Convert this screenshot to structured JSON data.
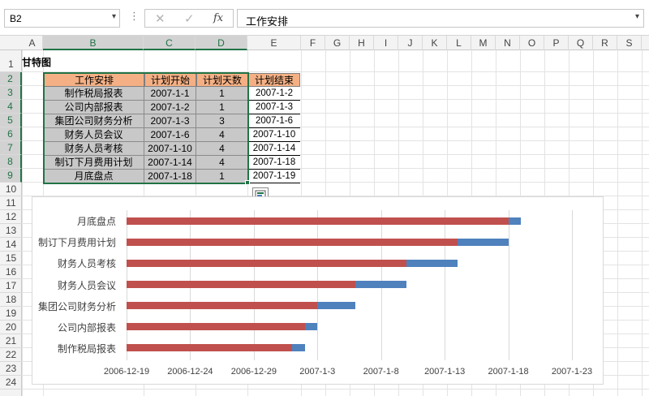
{
  "formula_bar": {
    "name_box": "B2",
    "formula": "工作安排",
    "fx_label": "fx",
    "cancel_glyph": "✕",
    "enter_glyph": "✓"
  },
  "columns": [
    "A",
    "B",
    "C",
    "D",
    "E",
    "F",
    "G",
    "H",
    "I",
    "J",
    "K",
    "L",
    "M",
    "N",
    "O",
    "P",
    "Q",
    "R",
    "S"
  ],
  "rows": [
    "1",
    "2",
    "3",
    "4",
    "5",
    "6",
    "7",
    "8",
    "9",
    "10",
    "11",
    "12",
    "13",
    "14",
    "15",
    "16",
    "17",
    "18",
    "19",
    "20",
    "21",
    "22",
    "23",
    "24"
  ],
  "sheet_title": "甘特图",
  "table": {
    "headers": [
      "工作安排",
      "计划开始",
      "计划天数",
      "计划结束"
    ],
    "rows": [
      [
        "制作税局报表",
        "2007-1-1",
        "1",
        "2007-1-2"
      ],
      [
        "公司内部报表",
        "2007-1-2",
        "1",
        "2007-1-3"
      ],
      [
        "集团公司财务分析",
        "2007-1-3",
        "3",
        "2007-1-6"
      ],
      [
        "财务人员会议",
        "2007-1-6",
        "4",
        "2007-1-10"
      ],
      [
        "财务人员考核",
        "2007-1-10",
        "4",
        "2007-1-14"
      ],
      [
        "制订下月费用计划",
        "2007-1-14",
        "4",
        "2007-1-18"
      ],
      [
        "月底盘点",
        "2007-1-18",
        "1",
        "2007-1-19"
      ]
    ]
  },
  "colors": {
    "start_series": "#c0504d",
    "days_series": "#4f81bd",
    "header_fill": "#f4b084",
    "selection": "#217346"
  },
  "chart_data": {
    "type": "bar",
    "orientation": "horizontal-stacked",
    "categories": [
      "制作税局报表",
      "公司内部报表",
      "集团公司财务分析",
      "财务人员会议",
      "财务人员考核",
      "制订下月费用计划",
      "月底盘点"
    ],
    "series": [
      {
        "values": [
          "2007-1-1",
          "2007-1-2",
          "2007-1-3",
          "2007-1-6",
          "2007-1-10",
          "2007-1-14",
          "2007-1-18"
        ]
      },
      {
        "values": [
          1,
          1,
          3,
          4,
          4,
          4,
          1
        ]
      }
    ],
    "x_ticks": [
      "2006-12-19",
      "2006-12-24",
      "2006-12-29",
      "2007-1-3",
      "2007-1-8",
      "2007-1-13",
      "2007-1-18",
      "2007-1-23"
    ],
    "xlim": [
      "2006-12-19",
      "2007-1-23"
    ],
    "grid": true,
    "legend": "none"
  }
}
